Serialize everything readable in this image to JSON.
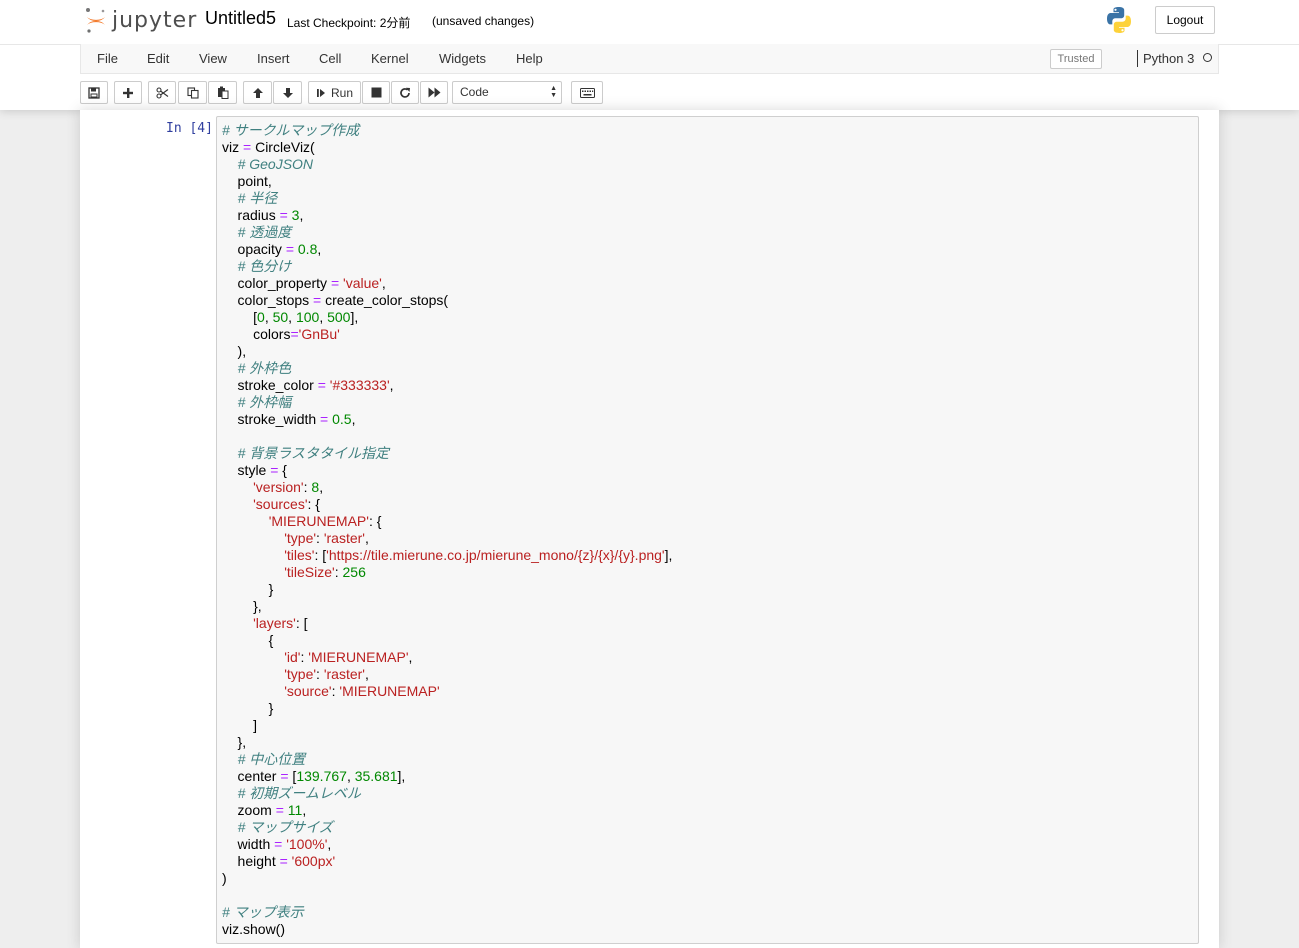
{
  "header": {
    "logo_text": "jupyter",
    "notebook_name": "Untitled5",
    "checkpoint": "Last Checkpoint: 2分前",
    "autosave_status": "(unsaved changes)",
    "logout_label": "Logout"
  },
  "menubar": {
    "items": [
      "File",
      "Edit",
      "View",
      "Insert",
      "Cell",
      "Kernel",
      "Widgets",
      "Help"
    ],
    "trusted_label": "Trusted",
    "kernel_name": "Python 3"
  },
  "toolbar": {
    "run_label": "Run",
    "cell_type": "Code"
  },
  "cell": {
    "prompt": "In [4]:",
    "code_lines": [
      "# サークルマップ作成",
      "viz = CircleViz(",
      "    # GeoJSON",
      "    point,",
      "    # 半径",
      "    radius = 3,",
      "    # 透過度",
      "    opacity = 0.8,",
      "    # 色分け",
      "    color_property = 'value',",
      "    color_stops = create_color_stops(",
      "        [0, 50, 100, 500],",
      "        colors='GnBu'",
      "    ),",
      "    # 外枠色",
      "    stroke_color = '#333333',",
      "    # 外枠幅",
      "    stroke_width = 0.5,",
      "",
      "    # 背景ラスタタイル指定",
      "    style = {",
      "        'version': 8,",
      "        'sources': {",
      "            'MIERUNEMAP': {",
      "                'type': 'raster',",
      "                'tiles': ['https://tile.mierune.co.jp/mierune_mono/{z}/{x}/{y}.png'],",
      "                'tileSize': 256",
      "            }",
      "        },",
      "        'layers': [",
      "            {",
      "                'id': 'MIERUNEMAP',",
      "                'type': 'raster',",
      "                'source': 'MIERUNEMAP'",
      "            }",
      "        ]",
      "    },",
      "    # 中心位置",
      "    center = [139.767, 35.681],",
      "    # 初期ズームレベル",
      "    zoom = 11,",
      "    # マップサイズ",
      "    width = '100%',",
      "    height = '600px'",
      ")",
      "",
      "# マップ表示",
      "viz.show()"
    ]
  },
  "colors": {
    "comment": "#408080",
    "operator": "#aa22ff",
    "number": "#008800",
    "string": "#ba2121",
    "prompt": "#303f9f",
    "logo_orange": "#f37726"
  }
}
